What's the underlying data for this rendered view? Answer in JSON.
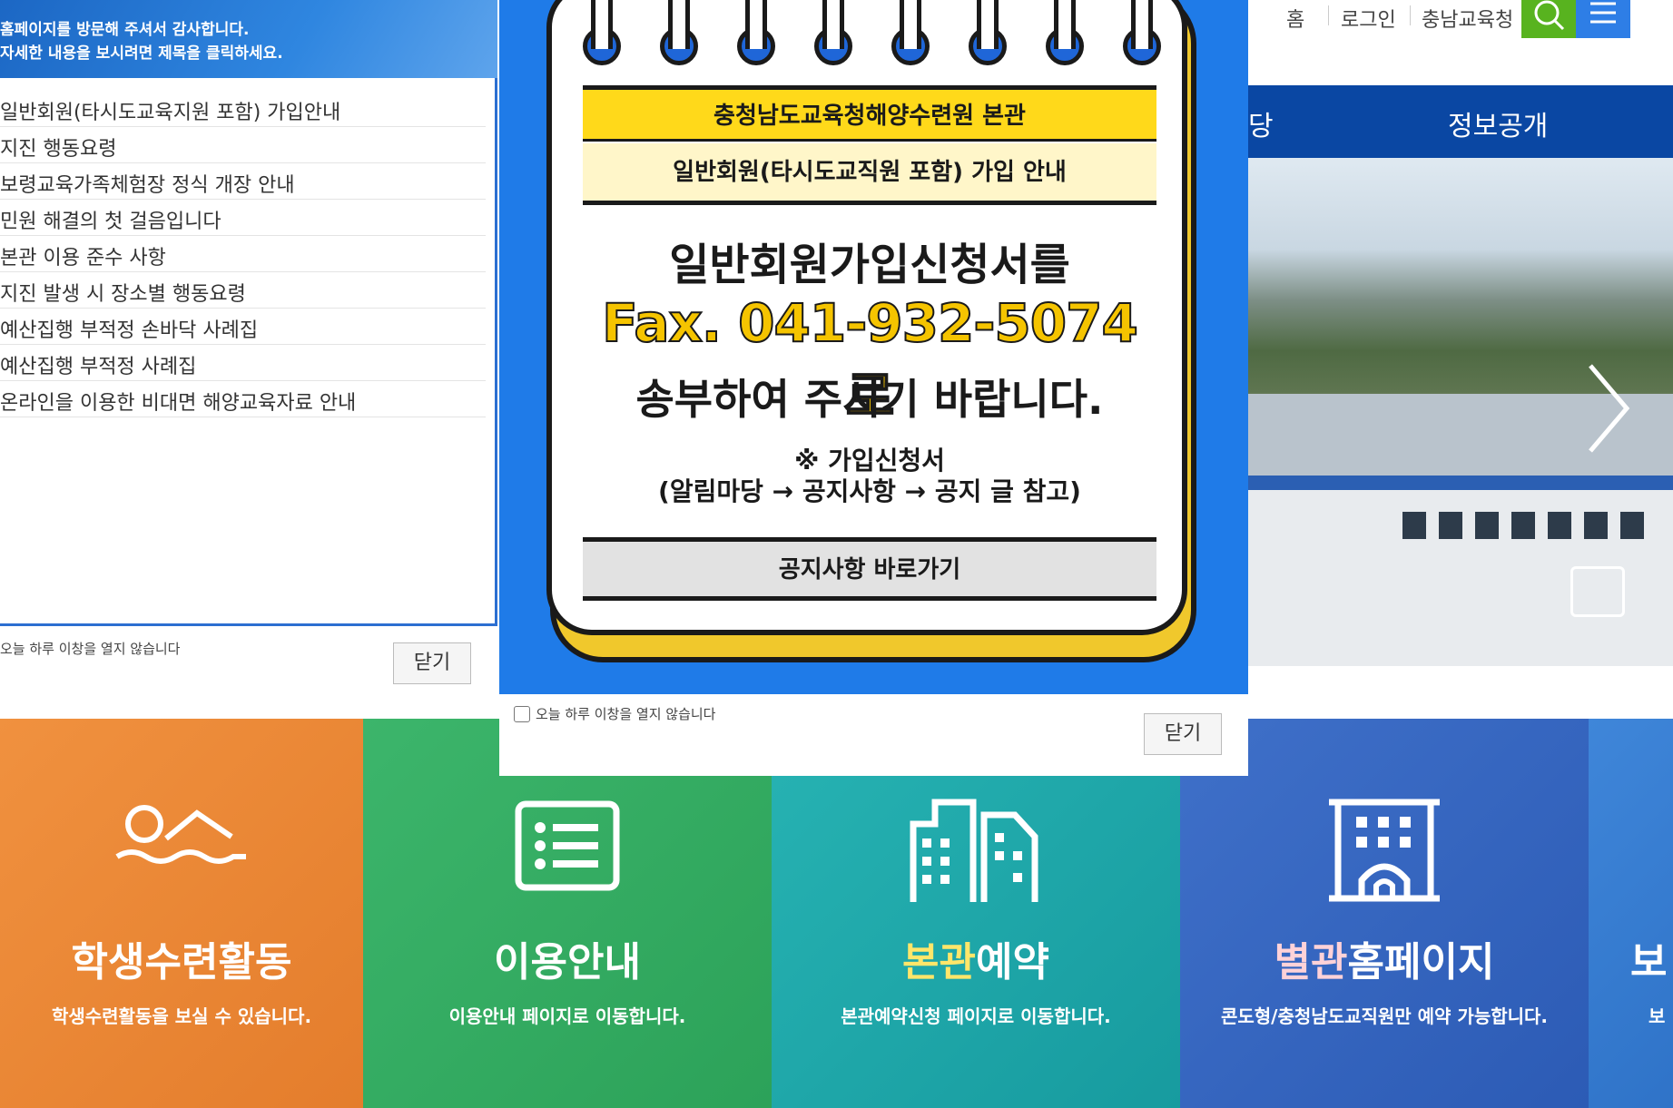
{
  "site": {
    "top_links": [
      "홈",
      "로그인",
      "충남교육청"
    ],
    "gnb_partial": "당",
    "gnb_item": "정보공개",
    "tiles": [
      {
        "title": "학생수련활동",
        "desc": "학생수련활동을 보실 수 있습니다.",
        "icon": "swimmer-icon"
      },
      {
        "title": "이용안내",
        "desc": "이용안내 페이지로 이동합니다.",
        "icon": "list-icon"
      },
      {
        "title_hl": "본관",
        "title_rest": "예약",
        "desc": "본관예약신청 페이지로 이동합니다.",
        "icon": "buildings-icon"
      },
      {
        "title_hl": "별관",
        "title_rest": "홈페이지",
        "desc": "콘도형/충청남도교직원만 예약 가능합니다.",
        "icon": "building-icon"
      },
      {
        "title": "보",
        "desc": "보"
      }
    ],
    "colors": {
      "orange": "#e8863a",
      "green": "#34ad62",
      "teal": "#22abab",
      "blue": "#3565bf",
      "brand_blue": "#0a47a3",
      "search_green": "#58b31f"
    }
  },
  "popup_notice": {
    "header_line1": "홈페이지를 방문해 주셔서 감사합니다.",
    "header_line2": "자세한 내용을 보시려면 제목을 클릭하세요.",
    "items": [
      "일반회원(타시도교육지원 포함) 가입안내",
      "지진 행동요령",
      "보령교육가족체험장 정식 개장 안내",
      "민원 해결의 첫 걸음입니다",
      "본관 이용 준수 사항",
      "지진 발생 시 장소별 행동요령",
      "예산집행 부적정 손바닥 사례집",
      "예산집행 부적정 사례집",
      "온라인을 이용한 비대면 해양교육자료 안내"
    ],
    "dont_show_label": "오늘 하루 이창을 열지 않습니다",
    "close_label": "닫기"
  },
  "popup_pad": {
    "header": "충청남도교육청해양수련원 본관",
    "subheader": "일반회원(타시도교직원 포함) 가입 안내",
    "line1": "일반회원가입신청서를",
    "fax": "Fax. 041-932-5074 로",
    "line3": "송부하여 주시기 바랍니다.",
    "note1": "※ 가입신청서",
    "note2": "(알림마당 → 공지사항 → 공지 글 참고)",
    "button": "공지사항 바로가기",
    "dont_show_label": "오늘 하루 이창을 열지 않습니다",
    "close_label": "닫기"
  }
}
